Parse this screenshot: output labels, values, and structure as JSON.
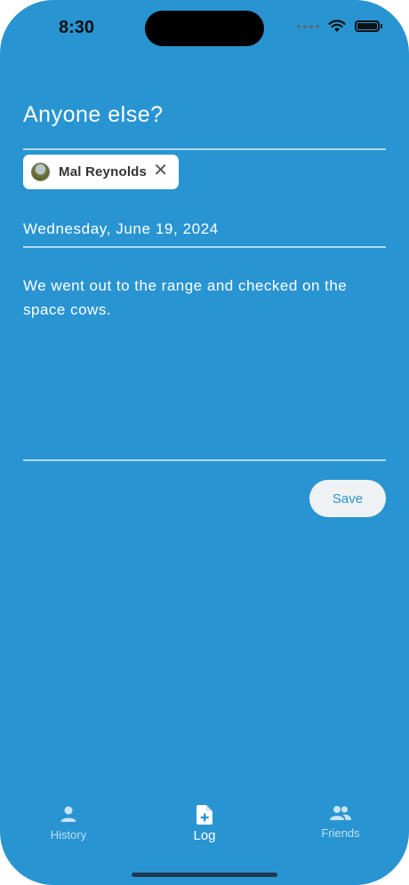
{
  "status_bar": {
    "time": "8:30"
  },
  "form": {
    "question": "Anyone else?",
    "selected_friends": [
      {
        "name": "Mal Reynolds"
      }
    ],
    "date": "Wednesday, June 19, 2024",
    "note": "We went out to the range and checked on the space cows.",
    "save_label": "Save"
  },
  "tab_bar": {
    "tabs": [
      {
        "label": "History",
        "icon": "person-icon",
        "active": false
      },
      {
        "label": "Log",
        "icon": "add-document-icon",
        "active": true
      },
      {
        "label": "Friends",
        "icon": "people-icon",
        "active": false
      }
    ]
  },
  "colors": {
    "background": "#2994d2",
    "chip": "#ffffff",
    "save_button": "#eef2f5",
    "accent": "#2994d2"
  }
}
